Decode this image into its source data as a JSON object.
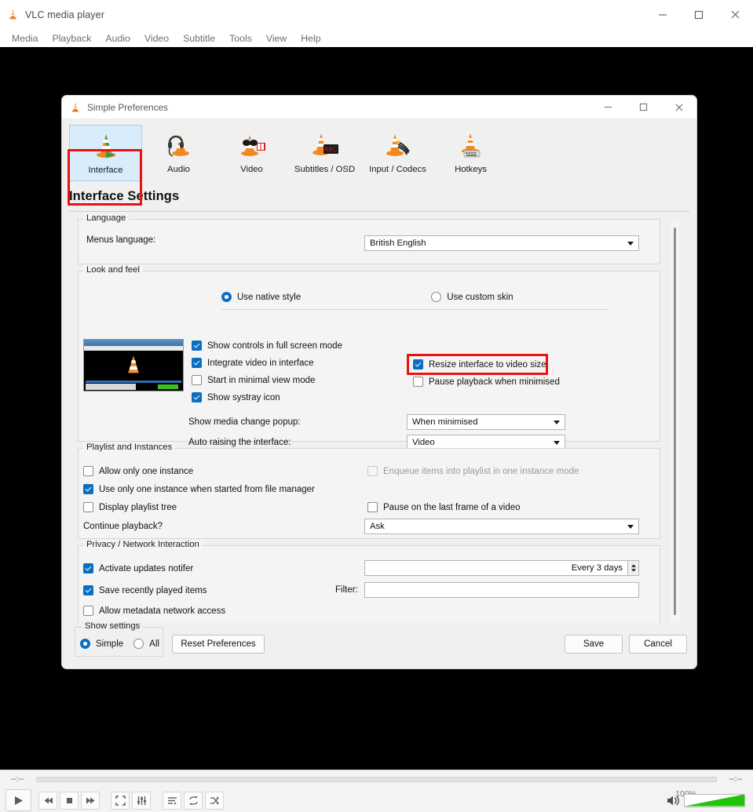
{
  "app": {
    "title": "VLC media player",
    "icon": "vlc-cone-icon"
  },
  "window_controls": {
    "minimize": "minimize-icon",
    "maximize": "maximize-icon",
    "close": "close-icon"
  },
  "menubar": {
    "items": [
      {
        "label": "Media"
      },
      {
        "label": "Playback"
      },
      {
        "label": "Audio"
      },
      {
        "label": "Video"
      },
      {
        "label": "Subtitle"
      },
      {
        "label": "Tools"
      },
      {
        "label": "View"
      },
      {
        "label": "Help"
      }
    ]
  },
  "playback_bar": {
    "time_elapsed": "--:--",
    "time_total": "--:--",
    "volume_percent": "100%",
    "volume_fill_color": "#22c40a",
    "buttons": [
      {
        "name": "play-button",
        "icon": "play-icon"
      },
      {
        "name": "previous-button",
        "icon": "skip-backward-icon"
      },
      {
        "name": "stop-button",
        "icon": "stop-icon"
      },
      {
        "name": "next-button",
        "icon": "skip-forward-icon"
      },
      {
        "name": "fullscreen-button",
        "icon": "fullscreen-icon"
      },
      {
        "name": "effects-button",
        "icon": "equalizer-icon"
      },
      {
        "name": "playlist-button",
        "icon": "playlist-icon"
      },
      {
        "name": "loop-button",
        "icon": "loop-icon"
      },
      {
        "name": "shuffle-button",
        "icon": "shuffle-icon"
      }
    ]
  },
  "dialog": {
    "title": "Simple Preferences",
    "icon": "vlc-cone-icon",
    "page_title": "Interface Settings",
    "categories": [
      {
        "label": "Interface",
        "icon": "cone-interface-icon",
        "selected": true,
        "highlighted": true
      },
      {
        "label": "Audio",
        "icon": "cone-headphones-icon",
        "selected": false,
        "highlighted": false
      },
      {
        "label": "Video",
        "icon": "cone-glasses-icon",
        "selected": false,
        "highlighted": false
      },
      {
        "label": "Subtitles / OSD",
        "icon": "cone-subtitles-icon",
        "selected": false,
        "highlighted": false
      },
      {
        "label": "Input / Codecs",
        "icon": "cone-cables-icon",
        "selected": false,
        "highlighted": false
      },
      {
        "label": "Hotkeys",
        "icon": "cone-keyboard-icon",
        "selected": false,
        "highlighted": false
      }
    ],
    "language_group": {
      "legend": "Language",
      "menus_language_label": "Menus language:",
      "menus_language_value": "British English"
    },
    "look_group": {
      "legend": "Look and feel",
      "radio_native": "Use native style",
      "radio_native_checked": true,
      "radio_skin": "Use custom skin",
      "radio_skin_checked": false,
      "checkboxes": [
        {
          "label": "Show controls in full screen mode",
          "checked": true,
          "highlighted": false,
          "column": "left"
        },
        {
          "label": "Integrate video in interface",
          "checked": true,
          "highlighted": false,
          "column": "left"
        },
        {
          "label": "Start in minimal view mode",
          "checked": false,
          "highlighted": false,
          "column": "left"
        },
        {
          "label": "Show systray icon",
          "checked": true,
          "highlighted": false,
          "column": "left"
        },
        {
          "label": "Resize interface to video size",
          "checked": true,
          "highlighted": true,
          "column": "right"
        },
        {
          "label": "Pause playback when minimised",
          "checked": false,
          "highlighted": false,
          "column": "right"
        }
      ],
      "media_popup_label": "Show media change popup:",
      "media_popup_value": "When minimised",
      "auto_raise_label": "Auto raising the interface:",
      "auto_raise_value": "Video"
    },
    "playlist_group": {
      "legend": "Playlist and Instances",
      "allow_one_instance": "Allow only one instance",
      "allow_one_instance_checked": false,
      "enqueue_items": "Enqueue items into playlist in one instance mode",
      "enqueue_items_checked": false,
      "enqueue_items_disabled": true,
      "use_one_instance": "Use only one instance when started from file manager",
      "use_one_instance_checked": true,
      "display_tree": "Display playlist tree",
      "display_tree_checked": false,
      "pause_last_frame": "Pause on the last frame of a video",
      "pause_last_frame_checked": false,
      "continue_playback_label": "Continue playback?",
      "continue_playback_value": "Ask"
    },
    "privacy_group": {
      "legend": "Privacy / Network Interaction",
      "activate_updates": "Activate updates notifer",
      "activate_updates_checked": true,
      "updates_interval_value": "Every 3 days",
      "save_recent": "Save recently played items",
      "save_recent_checked": true,
      "filter_label": "Filter:",
      "filter_value": "",
      "allow_metadata": "Allow metadata network access",
      "allow_metadata_checked": false
    },
    "footer": {
      "show_settings_legend": "Show settings",
      "simple_label": "Simple",
      "simple_checked": true,
      "all_label": "All",
      "all_checked": false,
      "reset_label": "Reset Preferences",
      "save_label": "Save",
      "cancel_label": "Cancel"
    }
  },
  "highlight_color": "#ee1111"
}
